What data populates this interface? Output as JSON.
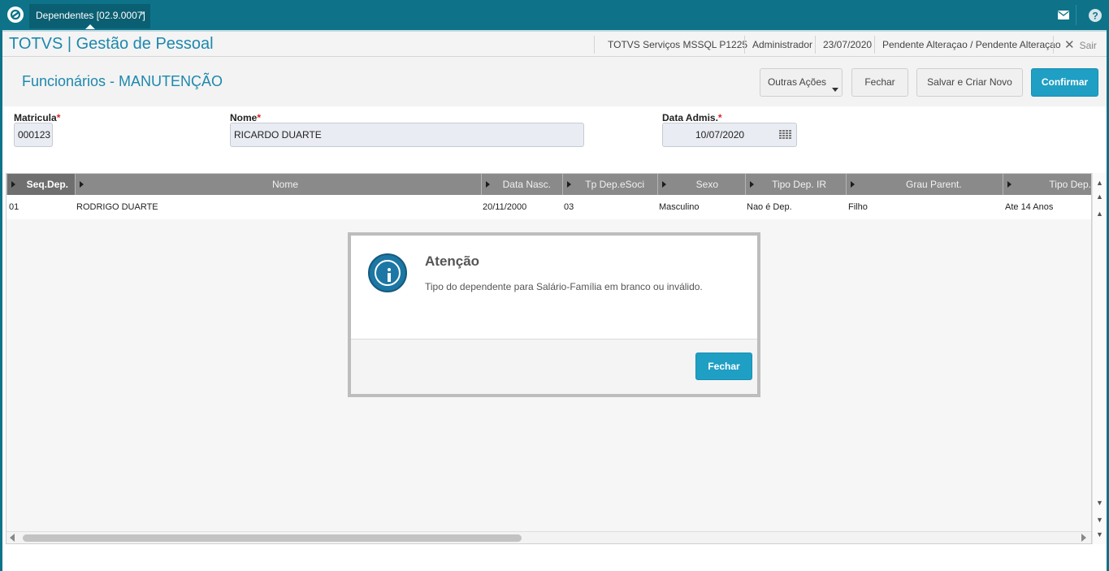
{
  "topbar": {
    "tab_label": "Dependentes [02.9.0007]",
    "tab_close": "×",
    "colors": {
      "bar": "#0e7389",
      "accent": "#1f9fc4"
    },
    "icons": [
      "totvs-logo-icon",
      "mail-icon",
      "help-icon"
    ]
  },
  "header": {
    "app_title": "TOTVS | Gestão de Pessoal",
    "environment": "TOTVS Serviços MSSQL P1225",
    "user": "Administrador",
    "date": "23/07/2020",
    "status": "Pendente Alteraçao / Pendente Alteraçao",
    "exit_label": "Sair"
  },
  "page": {
    "title": "Funcionários - MANUTENÇÃO",
    "buttons": {
      "more_actions": "Outras Ações",
      "close": "Fechar",
      "save_new": "Salvar e Criar Novo",
      "confirm": "Confirmar"
    }
  },
  "form": {
    "matricula": {
      "label": "Matricula",
      "value": "000123"
    },
    "nome": {
      "label": "Nome",
      "value": "RICARDO DUARTE"
    },
    "data_admis": {
      "label": "Data Admis.",
      "value": "10/07/2020"
    },
    "required_mark": "*"
  },
  "grid": {
    "columns": [
      "Seq.Dep.",
      "Nome",
      "Data Nasc.",
      "Tp Dep.eSoci",
      "Sexo",
      "Tipo Dep. IR",
      "Grau Parent.",
      "Tipo Dep."
    ],
    "rows": [
      [
        "01",
        "RODRIGO DUARTE",
        "20/11/2000",
        "03",
        "Masculino",
        "Nao é Dep.",
        "Filho",
        "Ate 14 Anos"
      ]
    ]
  },
  "dialog": {
    "title": "Atenção",
    "message": "Tipo do dependente para Salário-Família em branco ou inválido.",
    "button": "Fechar"
  }
}
